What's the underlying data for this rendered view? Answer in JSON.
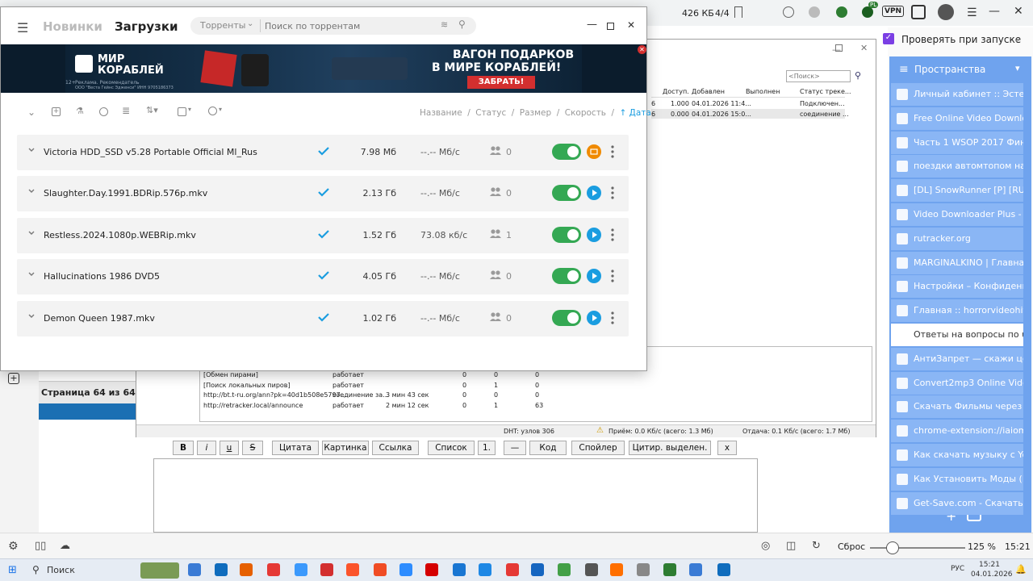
{
  "browser": {
    "downloaded": "426 КБ",
    "pages": "4/4",
    "vpn_badge": "VPN",
    "profile_badge": "PL"
  },
  "right_panel": {
    "check_label": "Проверять при запуске",
    "spaces_label": "Пространства",
    "tabs": [
      "Личный кабинет :: Эстейт",
      "Free Online Video Downlo",
      "Часть 1 WSOP 2017 Фина",
      "поездки автомтопом на г",
      "[DL] SnowRunner [P] [RUS",
      "Video Downloader Plus - И",
      "rutracker.org",
      "MARGINALKINO | Главная",
      "Настройки – Конфиденци",
      "Главная :: horrorvideohit.c",
      "Ответы на вопросы по uT",
      "АнтиЗапрет — скажи цен",
      "Convert2mp3 Online Video",
      "Скачать Фильмы через то",
      "chrome-extension://iaiomi",
      "Как скачать музыку с YouT",
      "Как Установить Моды (Ма",
      "Get-Save.com - Скачать ви"
    ]
  },
  "popup": {
    "tab_new": "Новинки",
    "tab_downloads": "Загрузки",
    "search_scope": "Торренты",
    "search_placeholder": "Поиск по торрентам",
    "banner": {
      "brand_line1": "МИР",
      "brand_line2": "КОРАБЛЕЙ",
      "headline1": "ВАГОН ПОДАРКОВ",
      "headline2": "В МИРЕ КОРАБЛЕЙ!",
      "cta": "ЗАБРАТЬ!",
      "ad_note": "Реклама. Рекомендатель",
      "ad_company": "ООО \"Веста Гейнс Эдженси\" ИНН 9705186373",
      "age": "12+"
    },
    "sort": {
      "name": "Название",
      "status": "Статус",
      "size": "Размер",
      "speed": "Скорость",
      "date": "↑ Дата",
      "sep": "/"
    },
    "torrents": [
      {
        "name": "Victoria HDD_SSD v5.28 Portable Official Ml_Rus",
        "size": "7.98 Мб",
        "speed": "--.-- Мб/с",
        "peers": "0",
        "action": "folder"
      },
      {
        "name": "Slaughter.Day.1991.BDRip.576p.mkv",
        "size": "2.13 Гб",
        "speed": "--.-- Мб/с",
        "peers": "0",
        "action": "play"
      },
      {
        "name": "Restless.2024.1080p.WEBRip.mkv",
        "size": "1.52 Гб",
        "speed": "73.08 кб/с",
        "peers": "1",
        "action": "play"
      },
      {
        "name": "Hallucinations 1986 DVD5",
        "size": "4.05 Гб",
        "speed": "--.-- Мб/с",
        "peers": "0",
        "action": "play"
      },
      {
        "name": "Demon Queen 1987.mkv",
        "size": "1.02 Гб",
        "speed": "--.-- Мб/с",
        "peers": "0",
        "action": "play"
      }
    ]
  },
  "utorrent": {
    "search_placeholder": "<Поиск>",
    "columns": [
      "Доступ.",
      "Добавлен",
      "Выполнен",
      "Статус треке..."
    ],
    "rows": [
      [
        "6",
        "1.000",
        "04.01.2026 11:4...",
        "",
        "Подключен..."
      ],
      [
        "6",
        "0.000",
        "04.01.2026 15:0...",
        "",
        "соединение ..."
      ]
    ],
    "trackers": [
      [
        "[Обмен пирами]",
        "работает",
        "",
        "0",
        "0",
        "0"
      ],
      [
        "[Поиск локальных пиров]",
        "работает",
        "",
        "0",
        "1",
        "0"
      ],
      [
        "http://bt.t-ru.org/ann?pk=40d1b508e5797...",
        "соединение за...",
        "3 мин 43 сек",
        "0",
        "0",
        "0"
      ],
      [
        "http://retracker.local/announce",
        "работает",
        "2 мин 12 сек",
        "0",
        "1",
        "63"
      ]
    ],
    "status_dht": "DHT: узлов 306",
    "status_down": "Приём: 0.0 Кб/с (всего: 1.3 Мб)",
    "status_up": "Отдача: 0.1 Кб/с (всего: 1.7 Мб)"
  },
  "page": {
    "page_label": "Страница 64 из 64"
  },
  "editor": {
    "buttons": [
      "B",
      "i",
      "u",
      "S",
      "Цитата",
      "Картинка",
      "Ссылка",
      "Список",
      "1.",
      "—",
      "Код",
      "Спойлер",
      "Цитир. выделен.",
      "x"
    ]
  },
  "statusbar": {
    "reset": "Сброс",
    "zoom": "125 %",
    "time": "15:21"
  },
  "taskbar": {
    "search": "Поиск",
    "lang": "РУС",
    "time": "15:21",
    "date": "04.01.2026"
  },
  "colors": {
    "accent_blue": "#1a9de0",
    "green": "#34a853",
    "orange": "#f08a00",
    "tab_blue": "#8ab6f5"
  }
}
